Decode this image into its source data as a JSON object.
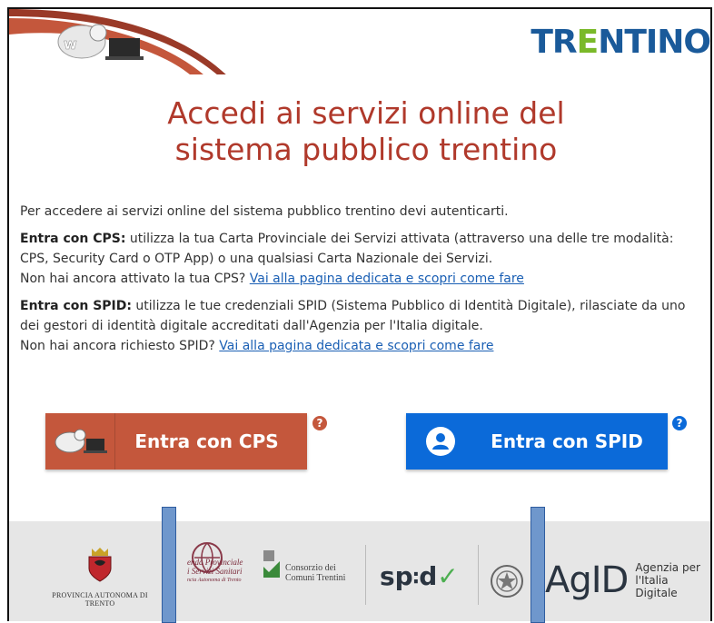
{
  "header": {
    "brand_left": "TRENTINO",
    "brand_tr": "TR",
    "brand_e": "E",
    "brand_ntino": "NTINO",
    "icons": [
      "cps-user-icon",
      "trentino-logo"
    ]
  },
  "title": {
    "line1": "Accedi ai servizi online del",
    "line2": "sistema pubblico trentino"
  },
  "intro": "Per accedere ai servizi online del sistema pubblico trentino devi autenticarti.",
  "cps": {
    "label": "Entra con CPS:",
    "text": " utilizza la tua Carta Provinciale dei Servizi attivata (attraverso una delle tre modalità: CPS, Security Card o OTP App) o una qualsiasi Carta Nazionale dei Servizi.",
    "question": "Non hai ancora attivato la tua CPS? ",
    "link": "Vai alla pagina dedicata e scopri come fare"
  },
  "spid": {
    "label": "Entra con SPID:",
    "text": " utilizza le tue credenziali SPID (Sistema Pubblico di Identità Digitale), rilasciate da uno dei gestori di identità digitale accreditati dall'Agenzia per l'Italia digitale.",
    "question": "Non hai ancora richiesto SPID? ",
    "link": "Vai alla pagina dedicata e scopri come fare"
  },
  "buttons": {
    "cps": "Entra con CPS",
    "spid": "Entra con SPID",
    "help": "?"
  },
  "footer": {
    "trento": "PROVINCIA AUTONOMA DI TRENTO",
    "apss_1": "enda Provinciale",
    "apss_2": "i Servizi Sanitari",
    "apss_3": "ncia Autonoma di Trento",
    "consorzio_1": "Consorzio dei",
    "consorzio_2": "Comuni Trentini",
    "spid_a": "sp",
    "spid_b": "d",
    "agid_big": "AgID",
    "agid_small_1": "Agenzia per",
    "agid_small_2": "l'Italia Digitale"
  },
  "colors": {
    "title": "#b0392b",
    "cps_button": "#c4573c",
    "spid_button": "#0b6ad9",
    "link": "#1a5fb4",
    "footer_bg": "#e6e6e6",
    "overlay_bar": "#6f97cc"
  }
}
